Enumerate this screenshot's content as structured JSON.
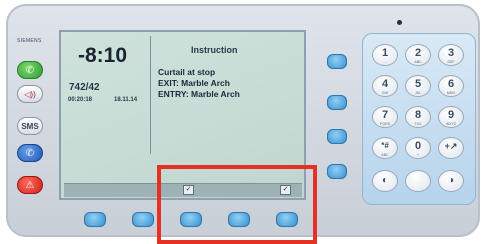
{
  "brand": {
    "text": "SIEMENS"
  },
  "side": {
    "call": "✆",
    "volume": "◁))",
    "sms": "SMS",
    "phone": "✆",
    "alarm": "⚠"
  },
  "display": {
    "time": "-8:10",
    "id_number": "742/42",
    "date_left": "00:20:18",
    "date_right": "18.11.14",
    "instruction_title": "Instruction",
    "lines": [
      "Curtail at stop",
      "EXIT:   Marble Arch",
      "ENTRY:  Marble Arch"
    ],
    "check_left": "✓",
    "check_right": "✓"
  },
  "keypad": {
    "keys": [
      {
        "d": "1",
        "s": "..."
      },
      {
        "d": "2",
        "s": "ABC"
      },
      {
        "d": "3",
        "s": "DEF"
      },
      {
        "d": "4",
        "s": "GHI"
      },
      {
        "d": "5",
        "s": "JKL"
      },
      {
        "d": "6",
        "s": "MNO"
      },
      {
        "d": "7",
        "s": "PQRS"
      },
      {
        "d": "8",
        "s": "TUV"
      },
      {
        "d": "9",
        "s": "WXYZ"
      },
      {
        "d": "*#",
        "s": "ABC"
      },
      {
        "d": "0",
        "s": "+"
      },
      {
        "d": "+↗",
        "s": ""
      }
    ],
    "bottom": [
      "◐",
      "",
      "◑"
    ]
  },
  "colors": {
    "accent_blue": "#3c8fd0",
    "alarm_red": "#d21f17",
    "call_green": "#2f9a3a",
    "highlight_red": "#e53024"
  }
}
